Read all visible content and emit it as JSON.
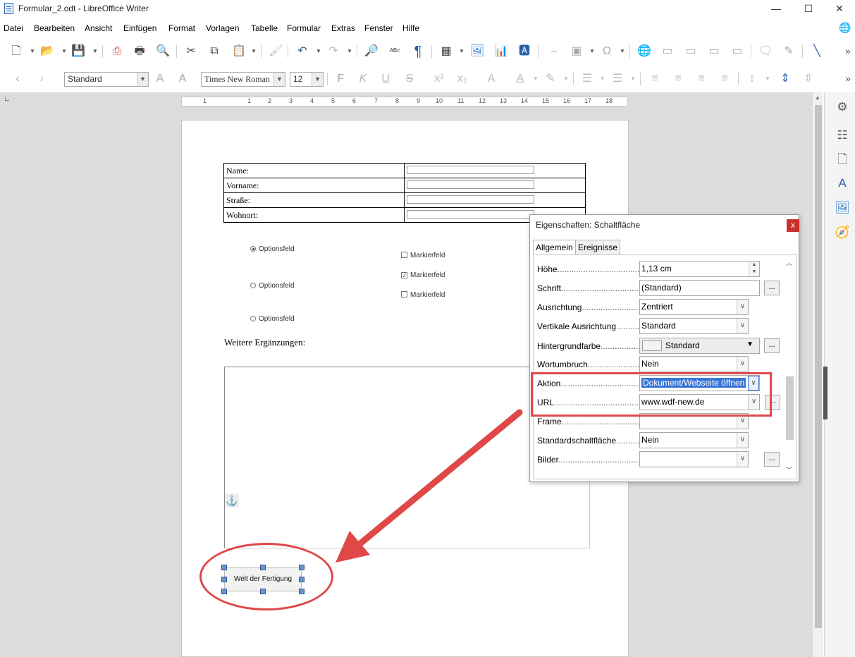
{
  "window": {
    "title": "Formular_2.odt - LibreOffice Writer",
    "minimize": "—",
    "maximize": "☐",
    "close": "✕"
  },
  "menu": [
    "Datei",
    "Bearbeiten",
    "Ansicht",
    "Einfügen",
    "Format",
    "Vorlagen",
    "Tabelle",
    "Formular",
    "Extras",
    "Fenster",
    "Hilfe"
  ],
  "format_toolbar": {
    "paragraph_style": "Standard",
    "font_name": "Times New Roman",
    "font_size": "12"
  },
  "ruler": [
    "1",
    "1",
    "2",
    "3",
    "4",
    "5",
    "6",
    "7",
    "8",
    "9",
    "10",
    "11",
    "12",
    "13",
    "14",
    "15",
    "16",
    "17",
    "18"
  ],
  "form": {
    "fields": [
      "Name:",
      "Vorname:",
      "Straße:",
      "Wohnort:"
    ],
    "options": [
      {
        "label": "Optionsfeld",
        "selected": true
      },
      {
        "label": "Optionsfeld",
        "selected": false
      },
      {
        "label": "Optionsfeld",
        "selected": false
      }
    ],
    "checkboxes": [
      {
        "label": "Markierfeld",
        "checked": false
      },
      {
        "label": "Markierfeld",
        "checked": true
      },
      {
        "label": "Markierfeld",
        "checked": false
      }
    ],
    "further_label": "Weitere Ergänzungen:",
    "anchor_icon": "anchor-icon",
    "button_label": "Welt der Fertigung"
  },
  "dialog": {
    "title": "Eigenschaften: Schaltfläche",
    "close_label": "x",
    "tabs": [
      "Allgemein",
      "Ereignisse"
    ],
    "active_tab": "Allgemein",
    "rows": {
      "hoehe": {
        "label": "Höhe",
        "value": "1,13 cm"
      },
      "schrift": {
        "label": "Schrift",
        "value": "(Standard)"
      },
      "ausrichtung": {
        "label": "Ausrichtung",
        "value": "Zentriert"
      },
      "vertikal": {
        "label": "Vertikale Ausrichtung",
        "value": "Standard"
      },
      "hintergrund": {
        "label": "Hintergrundfarbe",
        "value": "Standard"
      },
      "wortumbruch": {
        "label": "Wortumbruch",
        "value": "Nein"
      },
      "aktion": {
        "label": "Aktion",
        "value": "Dokument/Webseite öffnen"
      },
      "url": {
        "label": "URL",
        "value": "www.wdf-new.de"
      },
      "frame": {
        "label": "Frame",
        "value": ""
      },
      "standard": {
        "label": "Standardschaltfläche",
        "value": "Nein"
      },
      "bilder": {
        "label": "Bilder",
        "value": ""
      }
    },
    "dots_label": "...",
    "dotfill": ".................................................."
  },
  "colors": {
    "annotation_red": "#e04848",
    "selection_blue": "#3875d7",
    "close_red": "#c9302c"
  }
}
